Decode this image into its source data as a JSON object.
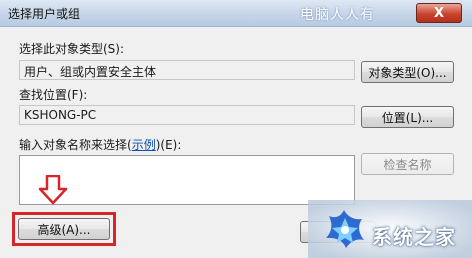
{
  "window": {
    "title": "选择用户或组",
    "watermark_top": "电脑人人有",
    "close_label": "X"
  },
  "object_type": {
    "label": "选择此对象类型(S):",
    "value": "用户、组或内置安全主体",
    "button": "对象类型(O)..."
  },
  "location": {
    "label": "查找位置(F):",
    "value": "KSHONG-PC",
    "button": "位置(L)..."
  },
  "names": {
    "label_prefix": "输入对象名称来选择(",
    "label_link": "示例",
    "label_suffix": ")(E):",
    "value": "",
    "check_button": "检查名称"
  },
  "buttons": {
    "advanced": "高级(A)..."
  },
  "watermark_brand": "系统之家",
  "colors": {
    "highlight": "#d6262a",
    "link": "#0b4fb3"
  }
}
